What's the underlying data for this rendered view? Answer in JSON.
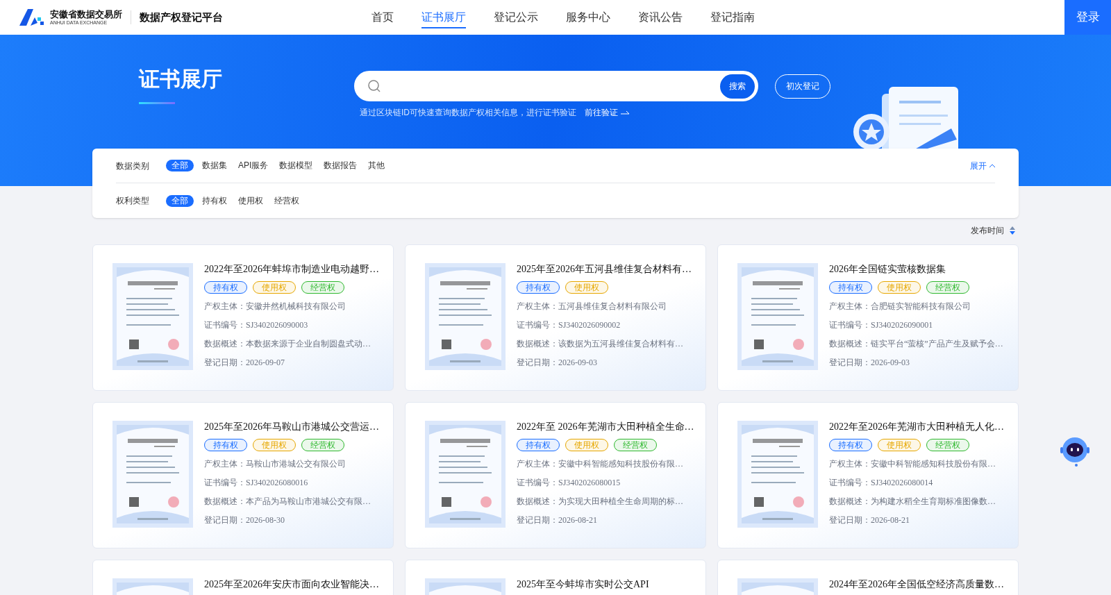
{
  "header": {
    "logo_name": "安徽省数据交易所",
    "logo_sub": "ANHUI DATA EXCHANGE",
    "platform": "数据产权登记平台",
    "nav": [
      {
        "label": "首页",
        "selected": false
      },
      {
        "label": "证书展厅",
        "selected": true
      },
      {
        "label": "登记公示",
        "selected": false
      },
      {
        "label": "服务中心",
        "selected": false
      },
      {
        "label": "资讯公告",
        "selected": false
      },
      {
        "label": "登记指南",
        "selected": false
      }
    ],
    "login": "登录"
  },
  "banner": {
    "title": "证书展厅",
    "search_button": "搜索",
    "register_button": "初次登记",
    "hint": "通过区块链ID可快速查询数据产权相关信息，进行证书验证",
    "verify_link": "前往验证"
  },
  "filters": [
    {
      "label": "数据类别",
      "options": [
        {
          "label": "全部",
          "selected": true
        },
        {
          "label": "数据集",
          "selected": false
        },
        {
          "label": "API服务",
          "selected": false
        },
        {
          "label": "数据模型",
          "selected": false
        },
        {
          "label": "数据报告",
          "selected": false
        },
        {
          "label": "其他",
          "selected": false
        }
      ]
    },
    {
      "label": "权利类型",
      "options": [
        {
          "label": "全部",
          "selected": true
        },
        {
          "label": "持有权",
          "selected": false
        },
        {
          "label": "使用权",
          "selected": false
        },
        {
          "label": "经营权",
          "selected": false
        }
      ]
    }
  ],
  "expand": "展开",
  "sort": "发布时间",
  "cards": [
    {
      "title": "2022年至2026年蚌埠市制造业电动越野…",
      "tags": [
        {
          "label": "持有权",
          "color": "#1a6dff"
        },
        {
          "label": "使用权",
          "color": "#e6a700"
        },
        {
          "label": "经营权",
          "color": "#2fb82f"
        }
      ],
      "lines": [
        "产权主体：安徽井然机械科技有限公司",
        "证书编号：SJ3402026090003",
        "数据概述：本数据来源于企业自制圆盘式动…",
        "登记日期：2026-09-07"
      ]
    },
    {
      "title": "2025年至2026年五河县维佳复合材料有…",
      "tags": [
        {
          "label": "持有权",
          "color": "#1a6dff"
        },
        {
          "label": "使用权",
          "color": "#e6a700"
        }
      ],
      "lines": [
        "产权主体：五河县维佳复合材料有限公司",
        "证书编号：SJ3402026090002",
        "数据概述：该数据为五河县维佳复合材料有…",
        "登记日期：2026-09-03"
      ]
    },
    {
      "title": "2026年全国链实萤核数据集",
      "tags": [
        {
          "label": "持有权",
          "color": "#1a6dff"
        },
        {
          "label": "使用权",
          "color": "#e6a700"
        },
        {
          "label": "经营权",
          "color": "#2fb82f"
        }
      ],
      "lines": [
        "产权主体：合肥链实智能科技有限公司",
        "证书编号：SJ3402026090001",
        "数据概述：链实平台“萤核”产品产生及赋予会…",
        "登记日期：2026-09-03"
      ]
    },
    {
      "title": "2025年至2026年马鞍山市港城公交营运…",
      "tags": [
        {
          "label": "持有权",
          "color": "#1a6dff"
        },
        {
          "label": "使用权",
          "color": "#e6a700"
        },
        {
          "label": "经营权",
          "color": "#2fb82f"
        }
      ],
      "lines": [
        "产权主体：马鞍山市港城公交有限公司",
        "证书编号：SJ3402026080016",
        "数据概述：本产品为马鞍山市港城公交有限…",
        "登记日期：2026-08-30"
      ]
    },
    {
      "title": "2022年至 2026年芜湖市大田种植全生命…",
      "tags": [
        {
          "label": "持有权",
          "color": "#1a6dff"
        },
        {
          "label": "使用权",
          "color": "#e6a700"
        },
        {
          "label": "经营权",
          "color": "#2fb82f"
        }
      ],
      "lines": [
        "产权主体：安徽中科智能感知科技股份有限…",
        "证书编号：SJ3402026080015",
        "数据概述：为实现大田种植全生命周期的标…",
        "登记日期：2026-08-21"
      ]
    },
    {
      "title": "2022年至2026年芜湖市大田种植无人化…",
      "tags": [
        {
          "label": "持有权",
          "color": "#1a6dff"
        },
        {
          "label": "使用权",
          "color": "#e6a700"
        },
        {
          "label": "经营权",
          "color": "#2fb82f"
        }
      ],
      "lines": [
        "产权主体：安徽中科智能感知科技股份有限…",
        "证书编号：SJ3402026080014",
        "数据概述：为构建水稻全生育期标准图像数…",
        "登记日期：2026-08-21"
      ]
    },
    {
      "title": "2025年至2026年安庆市面向农业智能决…"
    },
    {
      "title": "2025年至今蚌埠市实时公交API"
    },
    {
      "title": "2024年至2026年全国低空经济高质量数…"
    }
  ]
}
